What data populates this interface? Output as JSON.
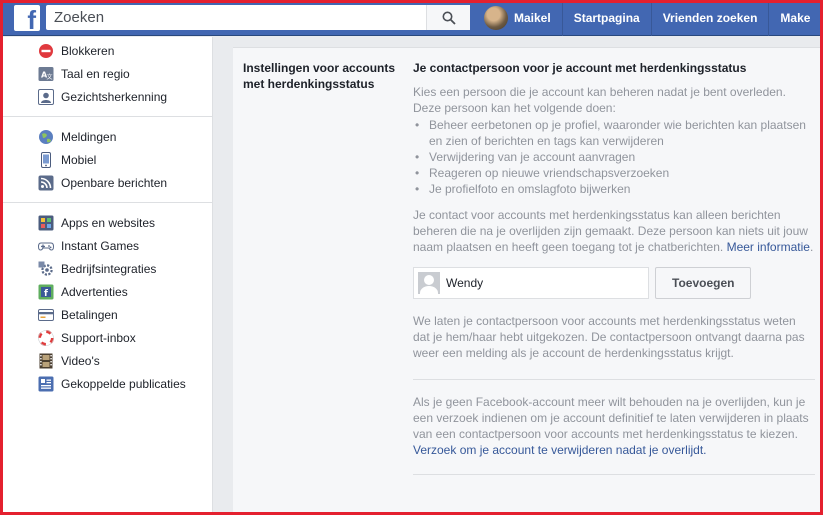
{
  "topbar": {
    "logo": "f",
    "search_placeholder": "Zoeken",
    "profile_name": "Maikel",
    "nav": [
      "Startpagina",
      "Vrienden zoeken",
      "Make"
    ]
  },
  "sidebar": {
    "group1": [
      {
        "label": "Blokkeren",
        "icon": "block-icon"
      },
      {
        "label": "Taal en regio",
        "icon": "language-icon"
      },
      {
        "label": "Gezichtsherkenning",
        "icon": "face-recognition-icon"
      }
    ],
    "group2": [
      {
        "label": "Meldingen",
        "icon": "globe-icon"
      },
      {
        "label": "Mobiel",
        "icon": "mobile-icon"
      },
      {
        "label": "Openbare berichten",
        "icon": "rss-icon"
      }
    ],
    "group3": [
      {
        "label": "Apps en websites",
        "icon": "apps-icon"
      },
      {
        "label": "Instant Games",
        "icon": "gamepad-icon"
      },
      {
        "label": "Bedrijfsintegraties",
        "icon": "gear-icon"
      },
      {
        "label": "Advertenties",
        "icon": "ads-icon"
      },
      {
        "label": "Betalingen",
        "icon": "credit-card-icon"
      },
      {
        "label": "Support-inbox",
        "icon": "lifebuoy-icon"
      },
      {
        "label": "Video's",
        "icon": "film-icon"
      },
      {
        "label": "Gekoppelde publicaties",
        "icon": "publication-icon"
      }
    ]
  },
  "main": {
    "section_title": "Instellingen voor accounts met herdenkingsstatus",
    "heading": "Je contactpersoon voor je account met herdenkingsstatus",
    "intro": "Kies een persoon die je account kan beheren nadat je bent overleden. Deze persoon kan het volgende doen:",
    "bullets": [
      "Beheer eerbetonen op je profiel, waaronder wie berichten kan plaatsen en zien of berichten en tags kan verwijderen",
      "Verwijdering van je account aanvragen",
      "Reageren op nieuwe vriendschapsverzoeken",
      "Je profielfoto en omslagfoto bijwerken"
    ],
    "contact_info": "Je contact voor accounts met herdenkingsstatus kan alleen berichten beheren die na je overlijden zijn gemaakt. Deze persoon kan niets uit jouw naam plaatsen en heeft geen toegang tot je chatberichten.",
    "more_info_link": "Meer informatie",
    "contact_value": "Wendy",
    "add_button": "Toevoegen",
    "notify_text": "We laten je contactpersoon voor accounts met herdenkingsstatus weten dat je hem/haar hebt uitgekozen. De contactpersoon ontvangt daarna pas weer een melding als je account de herdenkingsstatus krijgt.",
    "delete_text": "Als je geen Facebook-account meer wilt behouden na je overlijden, kun je een verzoek indienen om je account definitief te laten verwijderen in plaats van een contactpersoon voor accounts met herdenkingsstatus te kiezen.",
    "delete_link": "Verzoek om je account te verwijderen nadat je overlijdt."
  },
  "colors": {
    "brand": "#4267b2",
    "link": "#365899",
    "frame": "#e4202f"
  }
}
